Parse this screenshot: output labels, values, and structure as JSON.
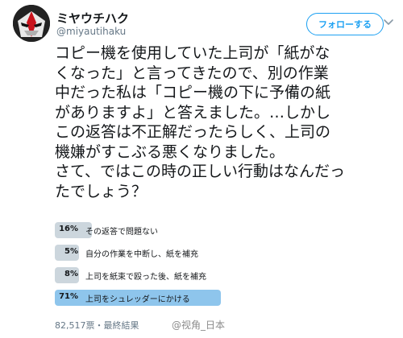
{
  "author": {
    "display_name": "ミヤウチハク",
    "handle": "@miyautihaku"
  },
  "follow_button": {
    "label": "フォローする"
  },
  "tweet": {
    "lines": [
      "コピー機を使用していた上司が「紙がな",
      "くなった」と言ってきたので、別の作業",
      "中だった私は「コピー機の下に予備の紙",
      "がありますよ」と答えました。…しかし",
      "この返答は不正解だったらしく、上司の",
      "機嫌がすこぶる悪くなりました。",
      "さて、ではこの時の正しい行動はなんだっ",
      "たでしょう？"
    ]
  },
  "poll": {
    "options": [
      {
        "percent_label": "16%",
        "percent": 16,
        "label": "その返答で問題ない",
        "winner": false
      },
      {
        "percent_label": "5%",
        "percent": 5,
        "label": "自分の作業を中断し、紙を補充",
        "winner": false
      },
      {
        "percent_label": "8%",
        "percent": 8,
        "label": "上司を紙束で殴った後、紙を補充",
        "winner": false
      },
      {
        "percent_label": "71%",
        "percent": 71,
        "label": "上司をシュレッダーにかける",
        "winner": true
      }
    ],
    "footer": "82,517票・最終結果"
  },
  "watermark": "@视角_日本",
  "colors": {
    "accent": "#1da1f2",
    "bar": "#ccd6dd",
    "bar_winner": "#8ec5ec",
    "muted_text": "#657786"
  },
  "icons": {
    "avatar": "masked-character-avatar",
    "menu": "chevron-down-icon"
  }
}
